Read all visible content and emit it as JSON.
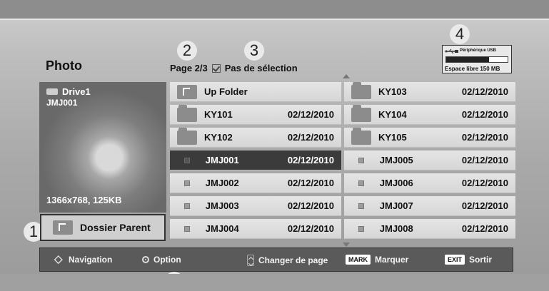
{
  "title": "Photo",
  "page_info": {
    "page": "Page 2/3",
    "selection": "Pas de sélection"
  },
  "callouts": [
    "1",
    "2",
    "3",
    "4",
    "5"
  ],
  "usb": {
    "device": "Périphérique USB",
    "free_space": "Espace libre 150 MB",
    "used_fraction": 0.7
  },
  "preview": {
    "drive": "Drive1",
    "file": "JMJ001",
    "info": "1366x768, 125KB"
  },
  "parent_button": "Dossier Parent",
  "columns": [
    [
      {
        "type": "up-folder",
        "name": "Up Folder",
        "date": ""
      },
      {
        "type": "folder",
        "name": "KY101",
        "date": "02/12/2010"
      },
      {
        "type": "folder",
        "name": "KY102",
        "date": "02/12/2010"
      },
      {
        "type": "photo",
        "name": "JMJ001",
        "date": "02/12/2010",
        "selected": true
      },
      {
        "type": "photo",
        "name": "JMJ002",
        "date": "02/12/2010"
      },
      {
        "type": "photo",
        "name": "JMJ003",
        "date": "02/12/2010"
      },
      {
        "type": "photo",
        "name": "JMJ004",
        "date": "02/12/2010"
      }
    ],
    [
      {
        "type": "folder",
        "name": "KY103",
        "date": "02/12/2010"
      },
      {
        "type": "folder",
        "name": "KY104",
        "date": "02/12/2010"
      },
      {
        "type": "folder",
        "name": "KY105",
        "date": "02/12/2010"
      },
      {
        "type": "photo",
        "name": "JMJ005",
        "date": "02/12/2010"
      },
      {
        "type": "photo",
        "name": "JMJ006",
        "date": "02/12/2010"
      },
      {
        "type": "photo",
        "name": "JMJ007",
        "date": "02/12/2010"
      },
      {
        "type": "photo",
        "name": "JMJ008",
        "date": "02/12/2010"
      }
    ]
  ],
  "footer": {
    "navigation": "Navigation",
    "option": "Option",
    "page_change": "Changer de page",
    "mark_key": "MARK",
    "mark_label": "Marquer",
    "exit_key": "EXIT",
    "exit_label": "Sortir"
  }
}
